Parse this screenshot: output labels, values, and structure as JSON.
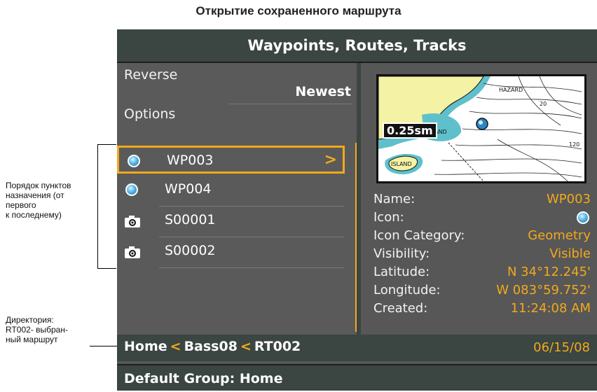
{
  "caption": {
    "title": "Открытие сохраненного маршрута"
  },
  "annotations": {
    "order_note": [
      "Порядок пунктов",
      "назначения (от",
      "первого",
      "к последнему)"
    ],
    "directory_note": [
      "Директория:",
      "RT002- выбран-",
      "ный маршрут"
    ]
  },
  "screen": {
    "title": "Waypoints, Routes, Tracks",
    "menu": {
      "reverse_label": "Reverse",
      "reverse_value": "Newest",
      "options_label": "Options"
    },
    "items": [
      {
        "name": "WP003",
        "icon": "waypoint-icon",
        "selected": true
      },
      {
        "name": "WP004",
        "icon": "waypoint-icon",
        "selected": false
      },
      {
        "name": "S00001",
        "icon": "camera-icon",
        "selected": false
      },
      {
        "name": "S00002",
        "icon": "camera-icon",
        "selected": false
      }
    ],
    "map": {
      "scale": "0.25sm",
      "labels": [
        "HAZARD",
        "20",
        "ISLAND",
        "ISLAND",
        "120"
      ]
    },
    "details": {
      "name_label": "Name:",
      "name_value": "WP003",
      "icon_label": "Icon:",
      "category_label": "Icon Category:",
      "category_value": "Geometry",
      "visibility_label": "Visibility:",
      "visibility_value": "Visible",
      "latitude_label": "Latitude:",
      "latitude_value": "N 34°12.245'",
      "longitude_label": "Longitude:",
      "longitude_value": "W 083°59.752'",
      "created_label": "Created:",
      "created_time": "11:24:08 AM",
      "created_date": "06/15/08"
    },
    "path": {
      "home": "Home",
      "folder": "Bass08",
      "route": "RT002"
    },
    "footer": "Default Group: Home"
  },
  "colors": {
    "accent": "#f2a91c",
    "panel": "#575757",
    "bar": "#3b4542",
    "land": "#f4f2a4",
    "shoal": "#5fc0cc"
  }
}
